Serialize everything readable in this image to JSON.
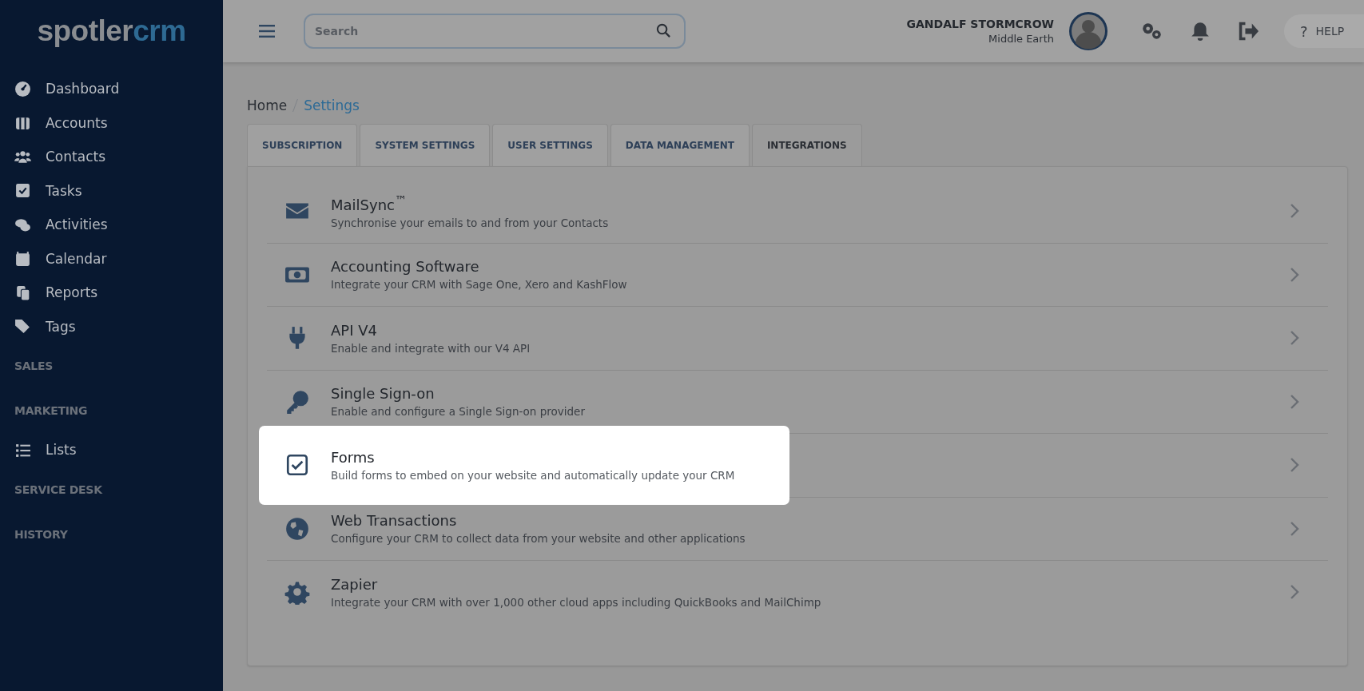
{
  "sidebar": {
    "logo": {
      "part_1": "spotler",
      "part_2": "crm"
    },
    "items": [
      {
        "kind": "link",
        "label": "Dashboard"
      },
      {
        "kind": "link",
        "label": "Accounts"
      },
      {
        "kind": "link",
        "label": "Contacts"
      },
      {
        "kind": "link",
        "label": "Tasks"
      },
      {
        "kind": "link",
        "label": "Activities"
      },
      {
        "kind": "link",
        "label": "Calendar"
      },
      {
        "kind": "link",
        "label": "Reports"
      },
      {
        "kind": "link",
        "label": "Tags"
      },
      {
        "kind": "section",
        "label": "SALES"
      },
      {
        "kind": "section",
        "label": "MARKETING"
      },
      {
        "kind": "link",
        "label": "Lists"
      },
      {
        "kind": "section",
        "label": "SERVICE DESK"
      },
      {
        "kind": "section",
        "label": "HISTORY"
      }
    ]
  },
  "header": {
    "search": {
      "placeholder": "Search"
    },
    "user": {
      "name": "GANDALF STORMCROW",
      "location": "Middle Earth"
    },
    "help": "HELP",
    "help_icon": "?"
  },
  "breadcrumb": [
    {
      "label": "Home",
      "current": false
    },
    {
      "label": "Settings",
      "current": true
    }
  ],
  "tabs": [
    {
      "label": "SUBSCRIPTION",
      "selected": false
    },
    {
      "label": "SYSTEM SETTINGS",
      "selected": false
    },
    {
      "label": "USER SETTINGS",
      "selected": false
    },
    {
      "label": "DATA MANAGEMENT",
      "selected": false
    },
    {
      "label": "INTEGRATIONS",
      "selected": true
    }
  ],
  "integrations": [
    {
      "title": "MailSync$^{™}$",
      "description": "Synchronise your emails to and from your Contacts",
      "highlighted": false
    },
    {
      "title": "Accounting Software",
      "description": "Integrate your CRM with Sage One, Xero and KashFlow",
      "highlighted": false
    },
    {
      "title": "API V4",
      "description": "Enable and integrate with our V4 API",
      "highlighted": false
    },
    {
      "title": "Single Sign-on",
      "description": "Enable and configure a Single Sign-on provider",
      "highlighted": false
    },
    {
      "title": "Forms",
      "description": "Build forms to embed on your website and automatically update your CRM",
      "highlighted": true
    },
    {
      "title": "Web Transactions",
      "description": "Configure your CRM to collect data from your website and other applications",
      "highlighted": false
    },
    {
      "title": "Zapier",
      "description": "Integrate your CRM with over 1,000 other cloud apps including QuickBooks and MailChimp",
      "highlighted": false
    }
  ]
}
